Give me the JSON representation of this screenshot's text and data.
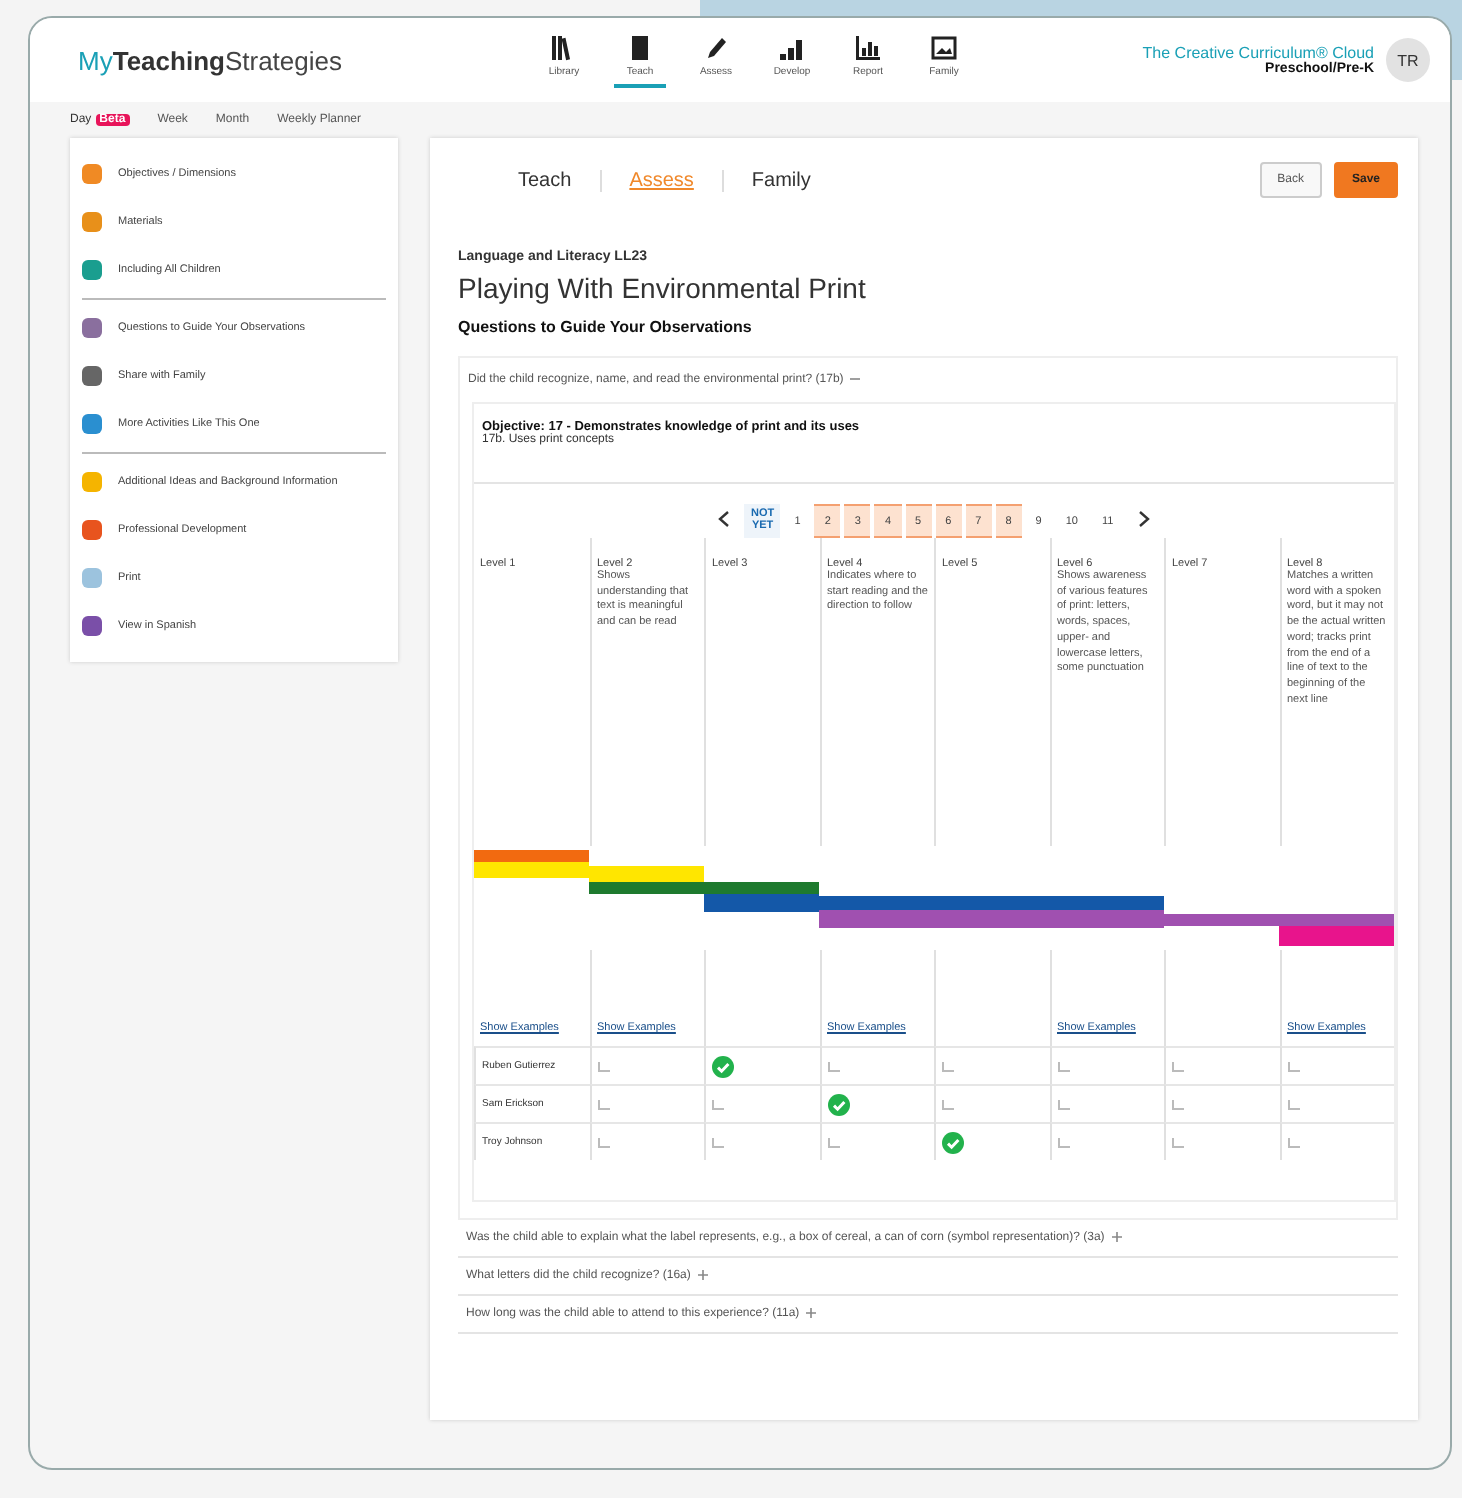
{
  "header": {
    "logo_light": "My",
    "logo_bold": "Teaching",
    "logo_rest": "Strategies",
    "nav": [
      {
        "label": "Library",
        "selected": false
      },
      {
        "label": "Teach",
        "selected": true
      },
      {
        "label": "Assess",
        "selected": false
      },
      {
        "label": "Develop",
        "selected": false
      },
      {
        "label": "Report",
        "selected": false
      },
      {
        "label": "Family",
        "selected": false
      }
    ],
    "product": "The Creative Curriculum® Cloud",
    "level": "Preschool/Pre-K",
    "avatar": "TR"
  },
  "views": [
    {
      "label": "Day",
      "badge": "Beta",
      "selected": true
    },
    {
      "label": "Week",
      "selected": false
    },
    {
      "label": "Month",
      "selected": false
    },
    {
      "label": "Weekly Planner",
      "selected": false
    }
  ],
  "sidebar": {
    "groups": [
      [
        "Objectives / Dimensions",
        "Materials",
        "Including All Children"
      ],
      [
        "Questions to Guide Your Observations",
        "Share with Family",
        "More Activities Like This One"
      ],
      [
        "Additional Ideas and Background Information",
        "Professional Development",
        "Print",
        "View in Spanish"
      ]
    ]
  },
  "tabs": [
    {
      "label": "Teach",
      "selected": false
    },
    {
      "label": "Assess",
      "selected": true
    },
    {
      "label": "Family",
      "selected": false
    }
  ],
  "buttons": {
    "back": "Back",
    "save": "Save"
  },
  "activity": {
    "category": "Language and Literacy LL23",
    "title": "Playing With Environmental Print",
    "section": "Questions to Guide Your Observations"
  },
  "questions": [
    {
      "text": "Did the child recognize, name, and read the environmental print? (17b)",
      "expanded": true,
      "objective": "Objective: 17 - Demonstrates knowledge of print and its uses",
      "dimension": "17b. Uses print concepts",
      "pages": [
        {
          "label": "NOT YET",
          "highlighted": false
        },
        {
          "label": "1",
          "highlighted": false
        },
        {
          "label": "2",
          "highlighted": true
        },
        {
          "label": "3",
          "highlighted": true
        },
        {
          "label": "4",
          "highlighted": true
        },
        {
          "label": "5",
          "highlighted": true
        },
        {
          "label": "6",
          "highlighted": true
        },
        {
          "label": "7",
          "highlighted": true
        },
        {
          "label": "8",
          "highlighted": true
        },
        {
          "label": "9",
          "highlighted": false
        },
        {
          "label": "10",
          "highlighted": false
        },
        {
          "label": "11",
          "highlighted": false
        }
      ],
      "levels": [
        {
          "name": "Level 1",
          "show_examples": "Show Examples"
        },
        {
          "name": "Level 2",
          "description": "Shows understanding that text is meaningful and can be read",
          "show_examples": "Show Examples"
        },
        {
          "name": "Level 3"
        },
        {
          "name": "Level 4",
          "description": "Indicates where to start reading and the direction to follow",
          "show_examples": "Show Examples"
        },
        {
          "name": "Level 5"
        },
        {
          "name": "Level 6",
          "description": "Shows awareness of various features of print: letters, words, spaces, upper- and lowercase letters, some punctuation",
          "show_examples": "Show Examples"
        },
        {
          "name": "Level 7"
        },
        {
          "name": "Level 8",
          "description": "Matches a written word with a spoken word, but it may not be the actual written word; tracks print from the end of a line of text to the beginning of the next line",
          "show_examples": "Show Examples"
        }
      ],
      "children": [
        {
          "name": "Ruben Gutierrez",
          "checked": [
            false,
            true,
            false,
            false,
            false,
            false,
            false
          ]
        },
        {
          "name": "Sam Erickson",
          "checked": [
            false,
            false,
            true,
            false,
            false,
            false,
            false
          ]
        },
        {
          "name": "Troy Johnson",
          "checked": [
            false,
            false,
            false,
            true,
            false,
            false,
            false
          ]
        }
      ]
    },
    {
      "text": "Was the child able to explain what the label represents, e.g., a box of cereal, a can of corn (symbol representation)? (3a)",
      "expanded": false
    },
    {
      "text": "What letters did the child recognize? (16a)",
      "expanded": false
    },
    {
      "text": "How long was the child able to attend to this experience? (11a)",
      "expanded": false
    }
  ]
}
